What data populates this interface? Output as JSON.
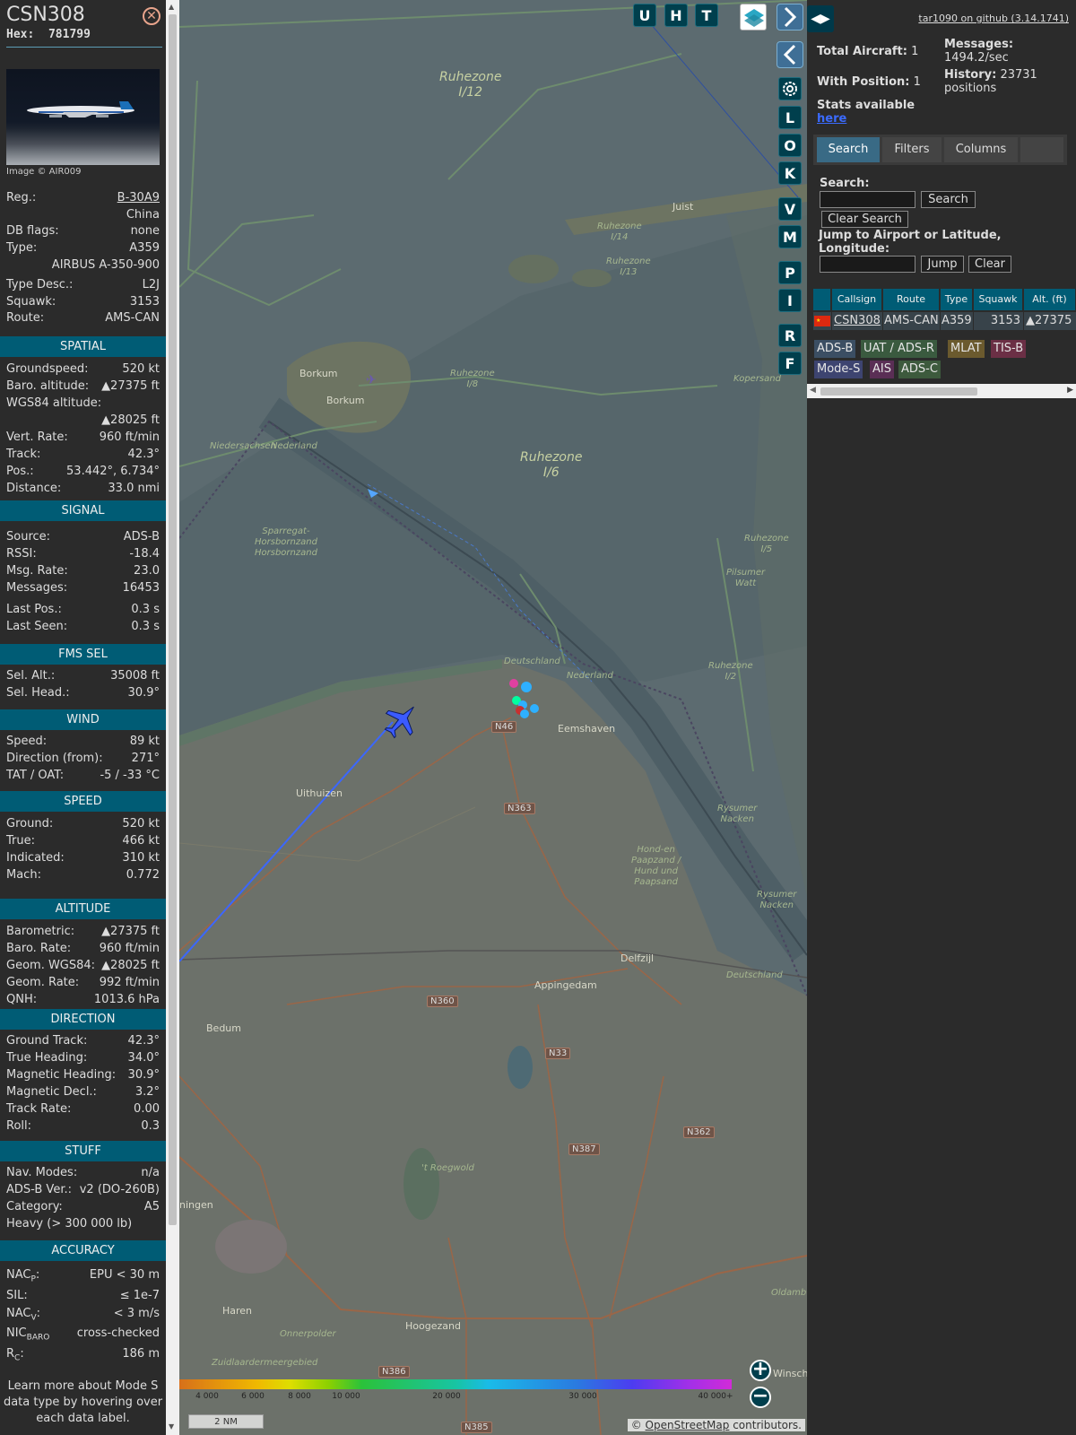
{
  "aircraft": {
    "callsign": "CSN308",
    "hex_label": "Hex:",
    "hex": "781799",
    "photo_credit": "Image © AIR009",
    "info": [
      {
        "k": "Reg.:",
        "v": "B-30A9"
      },
      {
        "k": "",
        "v": "China"
      },
      {
        "k": "DB flags:",
        "v": "none"
      },
      {
        "k": "Type:",
        "v": "A359"
      },
      {
        "k": "",
        "v": "AIRBUS A-350-900"
      },
      {
        "k": "Type Desc.:",
        "v": "L2J"
      },
      {
        "k": "Squawk:",
        "v": "3153"
      },
      {
        "k": "Route:",
        "v": "AMS-CAN"
      }
    ]
  },
  "sections": [
    {
      "title": "SPATIAL",
      "rows": [
        {
          "k": "Groundspeed:",
          "v": "520 kt"
        },
        {
          "k": "Baro. altitude:",
          "v": "▲27375 ft"
        },
        {
          "k": "WGS84 altitude:",
          "v": ""
        },
        {
          "k": "",
          "v": "▲28025 ft"
        },
        {
          "k": "Vert. Rate:",
          "v": "960 ft/min"
        },
        {
          "k": "Track:",
          "v": "42.3°"
        },
        {
          "k": "Pos.:",
          "v": "53.442°, 6.734°"
        },
        {
          "k": "Distance:",
          "v": "33.0 nmi"
        }
      ]
    },
    {
      "title": "SIGNAL",
      "rows": [
        {
          "k": "Source:",
          "v": "ADS-B"
        },
        {
          "k": "RSSI:",
          "v": "-18.4"
        },
        {
          "k": "Msg. Rate:",
          "v": "23.0"
        },
        {
          "k": "Messages:",
          "v": "16453"
        },
        {
          "k": "Last Pos.:",
          "v": "0.3 s"
        },
        {
          "k": "Last Seen:",
          "v": "0.3 s"
        }
      ]
    },
    {
      "title": "FMS SEL",
      "rows": [
        {
          "k": "Sel. Alt.:",
          "v": "35008 ft"
        },
        {
          "k": "Sel. Head.:",
          "v": "30.9°"
        }
      ]
    },
    {
      "title": "WIND",
      "rows": [
        {
          "k": "Speed:",
          "v": "89 kt"
        },
        {
          "k": "Direction (from):",
          "v": "271°"
        },
        {
          "k": "TAT / OAT:",
          "v": "-5 / -33 °C"
        }
      ]
    },
    {
      "title": "SPEED",
      "rows": [
        {
          "k": "Ground:",
          "v": "520 kt"
        },
        {
          "k": "True:",
          "v": "466 kt"
        },
        {
          "k": "Indicated:",
          "v": "310 kt"
        },
        {
          "k": "Mach:",
          "v": "0.772"
        }
      ]
    },
    {
      "title": "ALTITUDE",
      "rows": [
        {
          "k": "Barometric:",
          "v": "▲27375 ft"
        },
        {
          "k": "Baro. Rate:",
          "v": "960 ft/min"
        },
        {
          "k": "Geom. WGS84:",
          "v": "▲28025 ft"
        },
        {
          "k": "Geom. Rate:",
          "v": "992 ft/min"
        },
        {
          "k": "QNH:",
          "v": "1013.6 hPa"
        }
      ]
    },
    {
      "title": "DIRECTION",
      "rows": [
        {
          "k": "Ground Track:",
          "v": "42.3°"
        },
        {
          "k": "True Heading:",
          "v": "34.0°"
        },
        {
          "k": "Magnetic Heading:",
          "v": "30.9°"
        },
        {
          "k": "Magnetic Decl.:",
          "v": "3.2°"
        },
        {
          "k": "Track Rate:",
          "v": "0.00"
        },
        {
          "k": "Roll:",
          "v": "0.3"
        }
      ]
    },
    {
      "title": "STUFF",
      "rows": [
        {
          "k": "Nav. Modes:",
          "v": "n/a"
        },
        {
          "k": "ADS-B Ver.:",
          "v": "v2 (DO-260B)"
        },
        {
          "k": "Category:",
          "v": "A5"
        },
        {
          "k": "Heavy (> 300 000 lb)",
          "v": ""
        }
      ]
    },
    {
      "title": "ACCURACY",
      "rows": [
        {
          "k": "NAC",
          "sub": "P",
          "suffix": ":",
          "v": "EPU < 30 m"
        },
        {
          "k": "SIL:",
          "v": "≤ 1e-7"
        },
        {
          "k": "NAC",
          "sub": "V",
          "suffix": ":",
          "v": "< 3 m/s"
        },
        {
          "k": "NIC",
          "sub": "BARO",
          "suffix": "",
          "v": "cross-checked"
        },
        {
          "k": "R",
          "sub": "C",
          "suffix": ":",
          "v": "186 m"
        }
      ]
    }
  ],
  "footer_lines": [
    "Learn more about Mode S",
    "data type by hovering over",
    "each data label."
  ],
  "map": {
    "buttons": [
      "U",
      "H",
      "T"
    ],
    "side_buttons": [
      "L",
      "O",
      "K",
      "V",
      "M",
      "P",
      "I",
      "R",
      "F"
    ],
    "labels": {
      "ruhezone_i12": "Ruhezone\nI/12",
      "ruhezone_i6": "Ruhezone\nI/6",
      "borkum": "Borkum",
      "borkum2": "Borkum",
      "juist": "Juist",
      "uithuizen": "Uithuizen",
      "eemshaven": "Eemshaven",
      "delfzijl": "Delfzijl",
      "appingedam": "Appingedam",
      "bedum": "Bedum",
      "haren": "Haren",
      "hoogezand": "Hoogezand",
      "groningen": "ningen",
      "winsch": "Winsch",
      "deutschland": "Deutschland",
      "nederland": "Nederland",
      "deutschland2": "Deutschland",
      "nederland2": "Nederland",
      "niedersachsen": "Niedersachsen",
      "ruhezone_i14": "Ruhezone\nI/14",
      "ruhezone_i13": "Ruhezone\nI/13",
      "ruhezone_i5": "Ruhezone\nI/5",
      "ruhezone_i2": "Ruhezone\nI/2",
      "ruhezone_i8": "Ruhezone\nI/8",
      "sparregat": "Sparregat-\nHorsbornzand\nHorsbornzand",
      "pilsumer": "Pilsumer\nWatt",
      "rysumer": "Rysumer\nNacken",
      "rysumer2": "Rysumer\nNacken",
      "hond": "Hond-en\nPaapzand /\nHund und\nPaapsand",
      "kopersand": "Kopersand",
      "oldambt": "Oldambt",
      "roegwold": "'t Roegwold",
      "onnerpolder": "Onnerpolder",
      "zuidlaarder": "Zuidlaardermeergebied"
    },
    "roads": [
      "N46",
      "N363",
      "N360",
      "N33",
      "N387",
      "N362",
      "N386",
      "N385"
    ],
    "scale_label": "2 NM",
    "attribution_prefix": "© ",
    "attribution_link": "OpenStreetMap",
    "attribution_suffix": " contributors.",
    "altitude_ticks": [
      "4 000",
      "6 000",
      "8 000",
      "10 000",
      "20 000",
      "30 000",
      "40 000+"
    ]
  },
  "panel": {
    "github": "tar1090 on github (3.14.1741)",
    "total_aircraft_label": "Total Aircraft:",
    "total_aircraft": "1",
    "with_position_label": "With Position:",
    "with_position": "1",
    "messages_label": "Messages:",
    "messages_rate": "1494.2/sec",
    "history_label": "History:",
    "history_value": "23731",
    "history_unit": "positions",
    "stats_text": "Stats available",
    "stats_link": "here",
    "tabs": [
      "Search",
      "Filters",
      "Columns"
    ],
    "search_label": "Search:",
    "search_button": "Search",
    "clear_search_button": "Clear Search",
    "jump_label": "Jump to Airport or Latitude, Longitude:",
    "jump_button": "Jump",
    "clear_button": "Clear",
    "columns": [
      "Callsign",
      "Route",
      "Type",
      "Squawk",
      "Alt. (ft)"
    ],
    "row": {
      "callsign": "CSN308",
      "route": "AMS-CAN",
      "type": "A359",
      "squawk": "3153",
      "alt": "▲27375"
    },
    "source_badges": [
      {
        "label": "ADS-B",
        "bg": "#3b4e63"
      },
      {
        "label": "UAT / ADS-R",
        "bg": "#3a5a3f"
      },
      {
        "label": "MLAT",
        "bg": "#6b5a2e"
      },
      {
        "label": "TIS-B",
        "bg": "#6b2f45"
      },
      {
        "label": "Mode-S",
        "bg": "#3d4470"
      },
      {
        "label": "AIS",
        "bg": "#5a2e55"
      },
      {
        "label": "ADS-C",
        "bg": "#3d5a3d"
      }
    ]
  }
}
